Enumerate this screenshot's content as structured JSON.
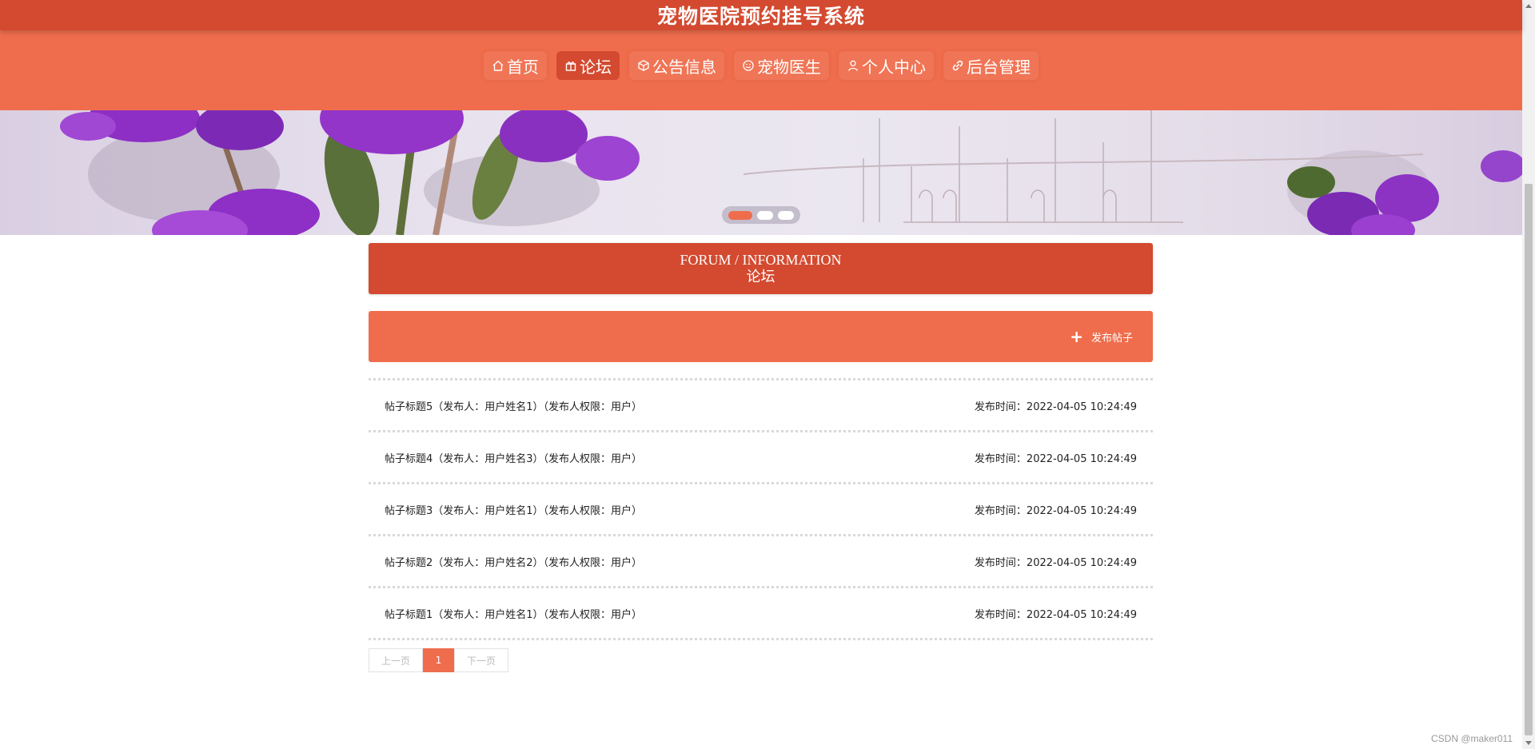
{
  "header": {
    "title": "宠物医院预约挂号系统"
  },
  "nav": {
    "items": [
      {
        "label": "首页",
        "icon": "home-icon",
        "active": false
      },
      {
        "label": "论坛",
        "icon": "gift-icon",
        "active": true
      },
      {
        "label": "公告信息",
        "icon": "cube-icon",
        "active": false
      },
      {
        "label": "宠物医生",
        "icon": "smile-icon",
        "active": false
      },
      {
        "label": "个人中心",
        "icon": "user-icon",
        "active": false
      },
      {
        "label": "后台管理",
        "icon": "link-icon",
        "active": false
      }
    ]
  },
  "colors": {
    "primary_dark": "#d34a30",
    "primary": "#ef6d4c"
  },
  "section": {
    "title_en": "FORUM / INFORMATION",
    "title_cn": "论坛"
  },
  "actions": {
    "post_label": "发布帖子"
  },
  "posts": [
    {
      "title": "帖子标题5（发布人：用户姓名1）（发布人权限：用户）",
      "time": "发布时间：2022-04-05 10:24:49"
    },
    {
      "title": "帖子标题4（发布人：用户姓名3）（发布人权限：用户）",
      "time": "发布时间：2022-04-05 10:24:49"
    },
    {
      "title": "帖子标题3（发布人：用户姓名1）（发布人权限：用户）",
      "time": "发布时间：2022-04-05 10:24:49"
    },
    {
      "title": "帖子标题2（发布人：用户姓名2）（发布人权限：用户）",
      "time": "发布时间：2022-04-05 10:24:49"
    },
    {
      "title": "帖子标题1（发布人：用户姓名1）（发布人权限：用户）",
      "time": "发布时间：2022-04-05 10:24:49"
    }
  ],
  "pagination": {
    "prev": "上一页",
    "current": "1",
    "next": "下一页"
  },
  "watermark": "CSDN @maker011"
}
